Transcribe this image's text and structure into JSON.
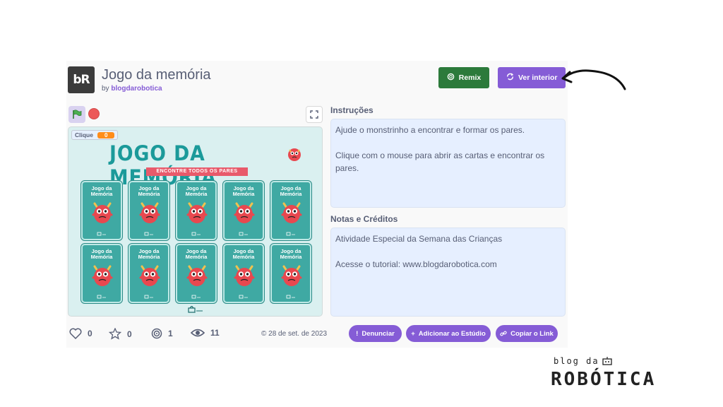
{
  "project": {
    "logo_text": "bR",
    "title": "Jogo da memória",
    "by_prefix": "by",
    "author": "blogdarobotica",
    "remix_label": "Remix",
    "see_inside_label": "Ver interior",
    "shared_date": "28 de set. de 2023"
  },
  "stage": {
    "monitor_label": "Clique",
    "monitor_value": "0",
    "game_title": "JOGO DA MEMÓRIA",
    "ribbon": "ENCONTRE TODOS OS PARES",
    "card_label_line1": "Jogo da",
    "card_label_line2": "Memória",
    "card_count": 10,
    "colors": {
      "teal": "#1b9a9a",
      "card": "#3fa9a3",
      "monster": "#e8484f",
      "ribbon": "#e85a6b"
    }
  },
  "instructions": {
    "heading": "Instruções",
    "paragraphs": [
      "Ajude o monstrinho a encontrar e formar os pares.",
      "Clique com o mouse para abrir as cartas e encontrar os pares."
    ]
  },
  "notes": {
    "heading": "Notas e Créditos",
    "paragraphs": [
      "Atividade Especial da Semana das Crianças",
      "Acesse o tutorial: www.blogdarobotica.com"
    ]
  },
  "stats": {
    "loves": "0",
    "favorites": "0",
    "remixes": "1",
    "views": "11"
  },
  "actions": {
    "report": "Denunciar",
    "add_studio": "Adicionar ao Estúdio",
    "copy_link": "Copiar o Link"
  },
  "watermark": {
    "top": "blog da",
    "main": "ROBÓTICA"
  },
  "accent_colors": {
    "purple": "#855cd6",
    "green": "#2c7a3b",
    "text": "#575e75"
  }
}
